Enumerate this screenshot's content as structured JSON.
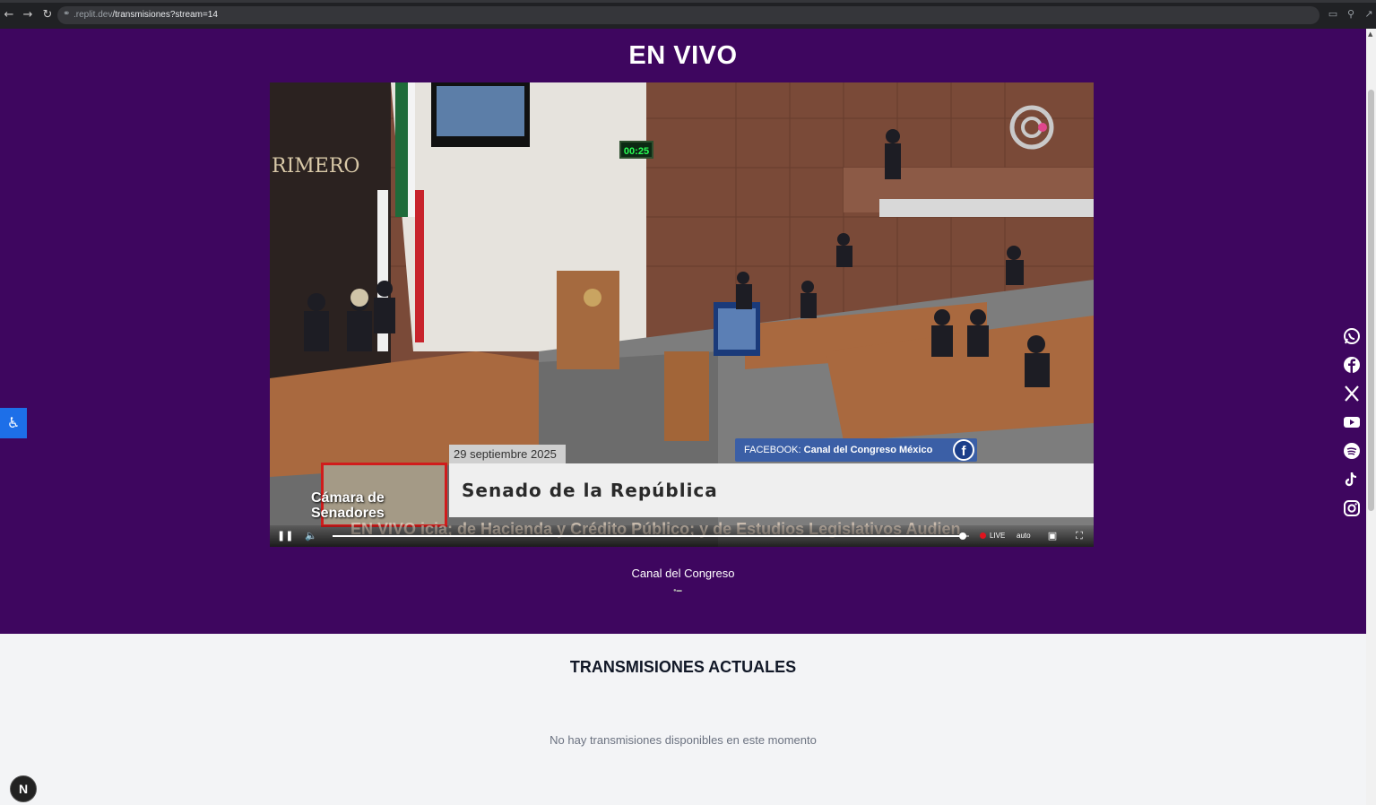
{
  "browser": {
    "url_host": ".replit.dev",
    "url_path": "/transmisiones?stream=14",
    "back_icon": "arrow-left-icon",
    "forward_icon": "arrow-right-icon",
    "reload_icon": "reload-icon"
  },
  "live": {
    "title": "EN VIVO",
    "channel_name": "Canal del Congreso",
    "player": {
      "overlay_date": "29 septiembre 2025",
      "overlay_facebook_prefix": "FACEBOOK:",
      "overlay_facebook_name": "Canal del Congreso México",
      "overlay_title": "Senado de la República",
      "overlay_logo_text_1": "Cámara de",
      "overlay_logo_text_2": "Senadores",
      "overlay_ticker": "EN VIVO   icia; de Hacienda y Crédito Público; y de Estudios Legislativos   Audien",
      "overlay_clock": "00:25",
      "overlay_wall_text": "RIMERO",
      "progress": 0.99,
      "live_label": "LIVE",
      "quality_label": "auto"
    }
  },
  "current": {
    "title": "TRANSMISIONES ACTUALES",
    "empty_message": "No hay transmisiones disponibles en este momento"
  },
  "social": [
    "whatsapp-icon",
    "facebook-icon",
    "x-icon",
    "youtube-icon",
    "spotify-icon",
    "tiktok-icon",
    "instagram-icon"
  ],
  "badge": {
    "letter": "N"
  },
  "colors": {
    "live_bg": "#3e065f",
    "page_bg": "#f3f4f6",
    "a11y_bg": "#1d6fe8",
    "live_dot": "#e0141e"
  }
}
